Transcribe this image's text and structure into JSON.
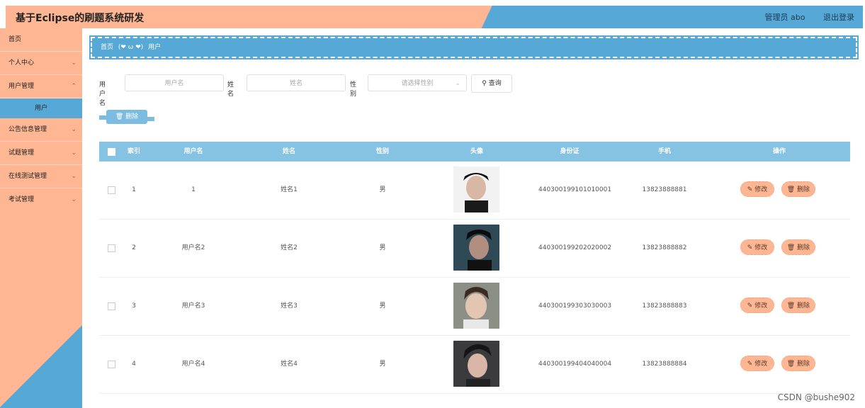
{
  "header": {
    "title": "基于Eclipse的刷题系统研发",
    "user": "管理员 abo",
    "logout": "退出登录"
  },
  "sidebar": {
    "items": [
      {
        "label": "首页",
        "chevron": false
      },
      {
        "label": "个人中心",
        "chevron": true
      },
      {
        "label": "用户管理",
        "chevron": true
      },
      {
        "label": "公告信息管理",
        "chevron": true
      },
      {
        "label": "试题管理",
        "chevron": true
      },
      {
        "label": "在线测试管理",
        "chevron": true
      },
      {
        "label": "考试管理",
        "chevron": true
      }
    ],
    "active_sub": "用户"
  },
  "breadcrumb": {
    "home": "首页",
    "emote": "(❤ ω ❤)",
    "current": "用户"
  },
  "search": {
    "username_label": "用户名",
    "username_placeholder": "用户名",
    "name_label": "姓名",
    "name_placeholder": "姓名",
    "gender_label": "性别",
    "gender_placeholder": "请选择性别",
    "query_label": "查询"
  },
  "toolbar": {
    "delete_label": "删除"
  },
  "table": {
    "columns": [
      "索引",
      "用户名",
      "姓名",
      "性别",
      "头像",
      "身份证",
      "手机",
      "操作"
    ],
    "rows": [
      {
        "index": "1",
        "username": "1",
        "name": "姓名1",
        "gender": "男",
        "id_card": "440300199101010001",
        "phone": "13823888881"
      },
      {
        "index": "2",
        "username": "用户名2",
        "name": "姓名2",
        "gender": "男",
        "id_card": "440300199202020002",
        "phone": "13823888882"
      },
      {
        "index": "3",
        "username": "用户名3",
        "name": "姓名3",
        "gender": "男",
        "id_card": "440300199303030003",
        "phone": "13823888883"
      },
      {
        "index": "4",
        "username": "用户名4",
        "name": "姓名4",
        "gender": "男",
        "id_card": "440300199404040004",
        "phone": "13823888884"
      }
    ],
    "edit_label": "修改",
    "delete_label": "删除"
  },
  "watermark": "CSDN @bushe902"
}
